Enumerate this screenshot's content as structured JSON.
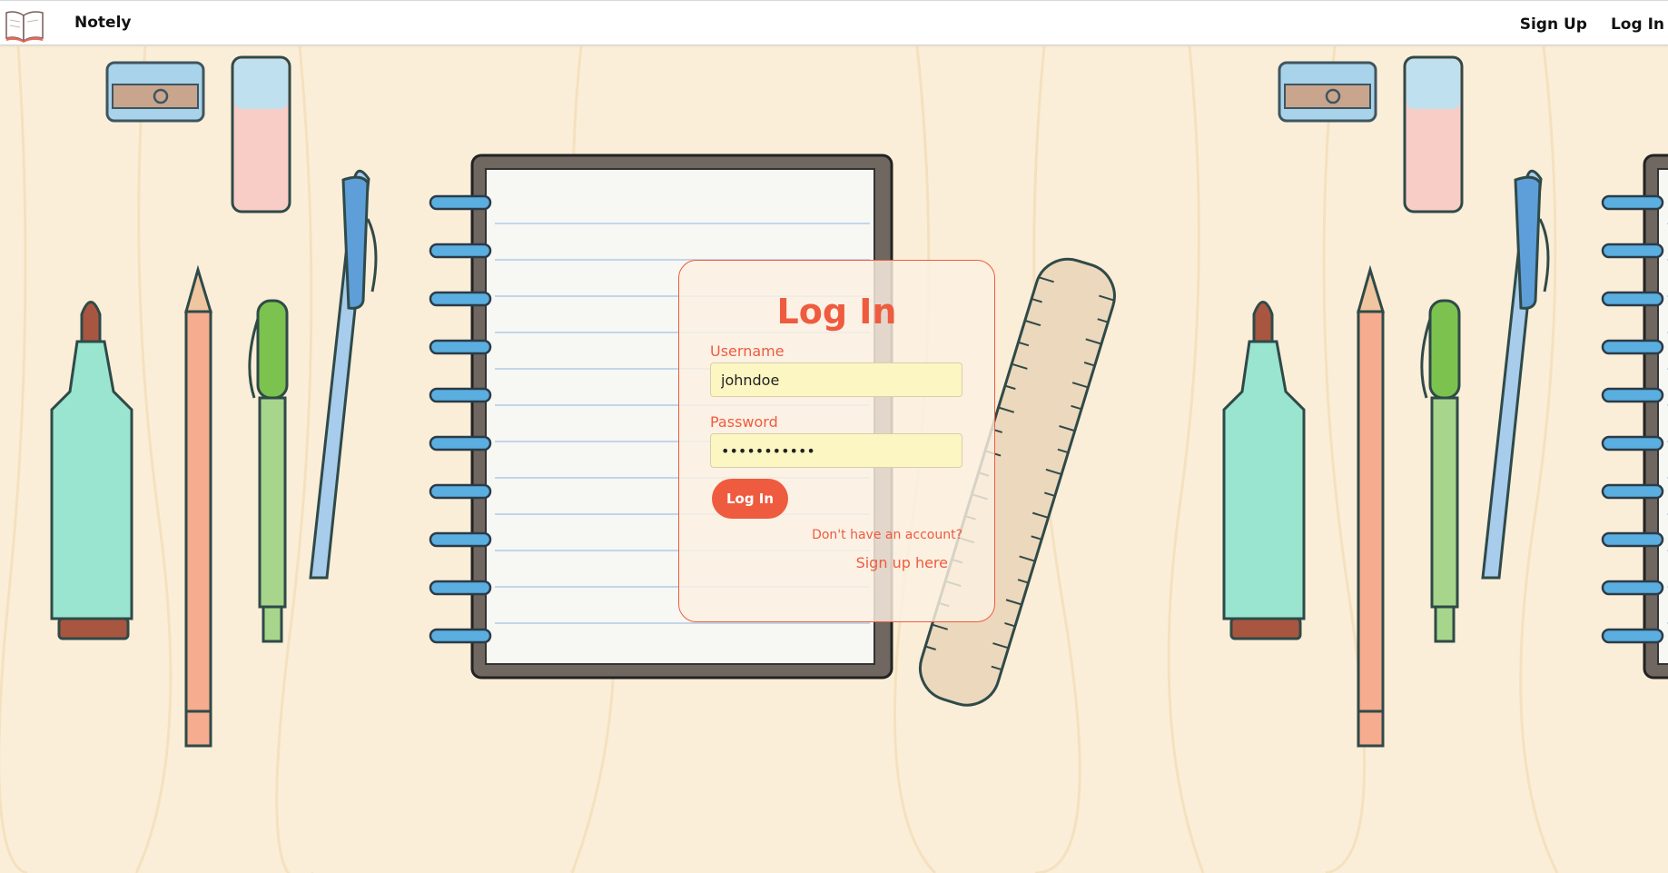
{
  "navbar": {
    "brand": "Notely",
    "links": [
      {
        "label": "Sign Up"
      },
      {
        "label": "Log In"
      }
    ]
  },
  "login_card": {
    "title": "Log In",
    "username_label": "Username",
    "username_value": "johndoe",
    "password_label": "Password",
    "password_value": "•••••••••••",
    "submit_label": "Log In",
    "no_account_text": "Don't have an account?",
    "signup_link": "Sign up here"
  },
  "colors": {
    "accent": "#ef5b3f",
    "input_bg": "#fcf6c3",
    "background": "#fbeed8"
  },
  "icons": {
    "logo": "open-book-icon"
  }
}
